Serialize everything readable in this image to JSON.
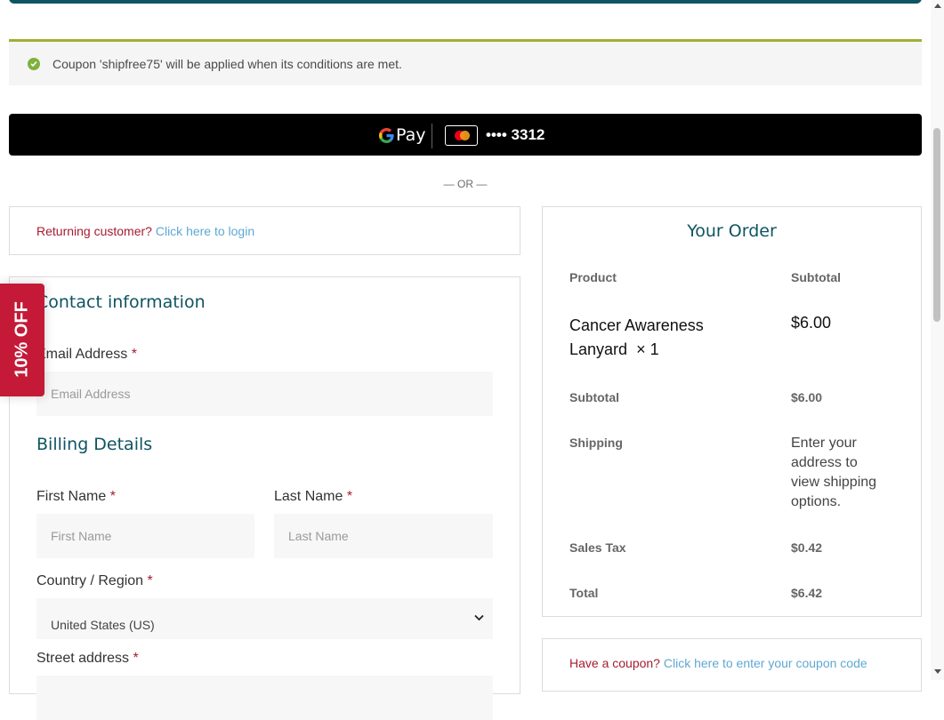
{
  "notice": {
    "message": "Coupon 'shipfree75' will be applied when its conditions are met.",
    "icon": "check-circle-icon",
    "accent": "#a1b030"
  },
  "gpay": {
    "logo_text": "Pay",
    "card_mask": "•••• 3312",
    "card_brand": "mastercard"
  },
  "separator": "— OR —",
  "returning": {
    "prompt": "Returning customer?",
    "link": "Click here to login"
  },
  "contact": {
    "title": "Contact information",
    "email_label": "Email Address",
    "email_placeholder": "Email Address",
    "required": "*"
  },
  "billing": {
    "title": "Billing Details",
    "first_name_label": "First Name",
    "first_name_placeholder": "First Name",
    "last_name_label": "Last Name",
    "last_name_placeholder": "Last Name",
    "country_label": "Country / Region",
    "country_value": "United States (US)",
    "street_label": "Street address"
  },
  "order": {
    "title": "Your Order",
    "col_product": "Product",
    "col_subtotal": "Subtotal",
    "product_name": "Cancer Awareness Lanyard",
    "product_qty": "× 1",
    "product_price": "$6.00",
    "subtotal_label": "Subtotal",
    "subtotal_value": "$6.00",
    "shipping_label": "Shipping",
    "shipping_value": "Enter your address to view shipping options.",
    "tax_label": "Sales Tax",
    "tax_value": "$0.42",
    "total_label": "Total",
    "total_value": "$6.42"
  },
  "coupon": {
    "prompt": "Have a coupon?",
    "link": "Click here to enter your coupon code"
  },
  "discount_tab": "10% OFF",
  "colors": {
    "brand": "#0f5462",
    "required": "#a51c30",
    "link": "#5fa8d3",
    "discount": "#c41a38"
  }
}
